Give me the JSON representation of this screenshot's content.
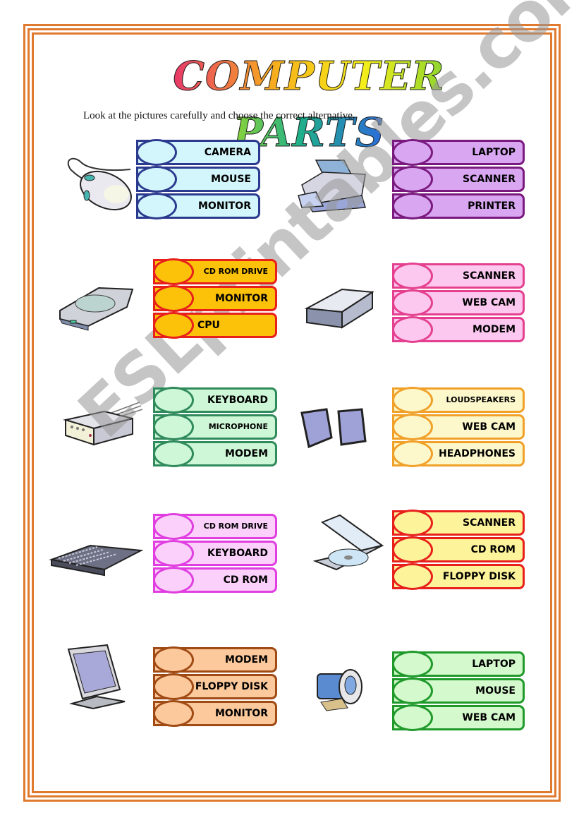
{
  "title": "COMPUTER PARTS",
  "instructions": "Look at the pictures carefully and choose the correct alternative.",
  "watermark": "ESLprintables.com",
  "items": [
    {
      "picture": "mouse-icon",
      "border": "#2b3a8f",
      "fill": "#d2f6fb",
      "options": [
        "CAMERA",
        "MOUSE",
        "MONITOR"
      ]
    },
    {
      "picture": "printer-icon",
      "border": "#7a1a7e",
      "fill": "#d9a6f2",
      "options": [
        "LAPTOP",
        "SCANNER",
        "PRINTER"
      ]
    },
    {
      "picture": "cd-rom-drive-icon",
      "border": "#e8201c",
      "fill": "#fcc20a",
      "options": [
        "CD ROM DRIVE",
        "MONITOR",
        "CPU"
      ]
    },
    {
      "picture": "scanner-icon",
      "border": "#e4408f",
      "fill": "#fcc8f0",
      "options": [
        "SCANNER",
        "WEB CAM",
        "MODEM"
      ]
    },
    {
      "picture": "modem-icon",
      "border": "#2f8a5c",
      "fill": "#cdf7d6",
      "options": [
        "KEYBOARD",
        "MICROPHONE",
        "MODEM"
      ]
    },
    {
      "picture": "loudspeakers-icon",
      "border": "#f1a028",
      "fill": "#fdf8cc",
      "options": [
        "LOUDSPEAKERS",
        "WEB CAM",
        "HEADPHONES"
      ]
    },
    {
      "picture": "keyboard-icon",
      "border": "#e03ee0",
      "fill": "#fbd0fb",
      "options": [
        "CD ROM DRIVE",
        "KEYBOARD",
        "CD ROM"
      ]
    },
    {
      "picture": "cd-rom-icon",
      "border": "#e8201c",
      "fill": "#fdf39a",
      "options": [
        "SCANNER",
        "CD ROM",
        "FLOPPY DISK"
      ]
    },
    {
      "picture": "monitor-icon",
      "border": "#a04a14",
      "fill": "#fcc99c",
      "options": [
        "MODEM",
        "FLOPPY DISK",
        "MONITOR"
      ]
    },
    {
      "picture": "web-cam-icon",
      "border": "#1f9a2a",
      "fill": "#d3f9cc",
      "options": [
        "LAPTOP",
        "MOUSE",
        "WEB CAM"
      ]
    }
  ]
}
